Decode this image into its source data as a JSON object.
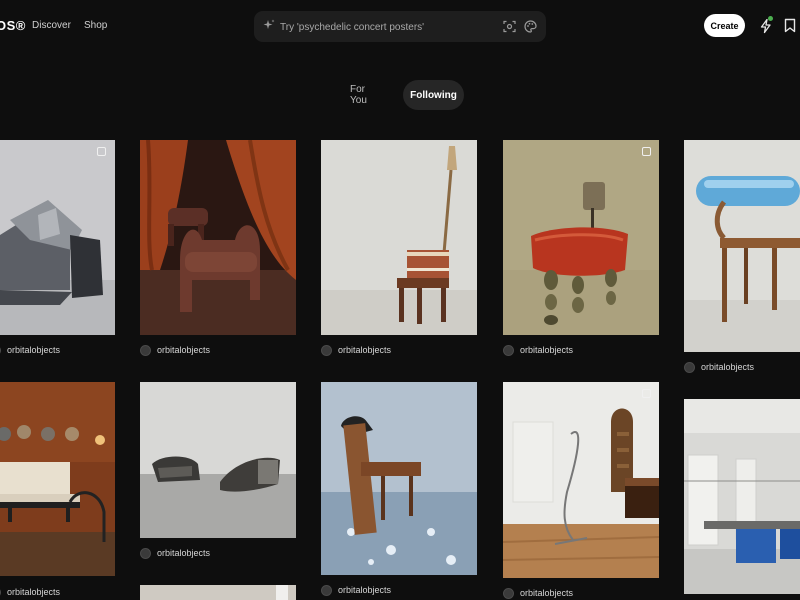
{
  "header": {
    "logo_text": "OS®",
    "nav": [
      "Discover",
      "Shop"
    ],
    "search_placeholder": "Try 'psychedelic concert posters'",
    "create_label": "Create",
    "notification_dot_color": "#4caf50"
  },
  "tabs": [
    {
      "label": "For You",
      "active": false
    },
    {
      "label": "Following",
      "active": true
    }
  ],
  "feed": {
    "author": "orbitalobjects",
    "cards": [
      {
        "name": "card-1",
        "author": "orbitalobjects",
        "multi": true
      },
      {
        "name": "card-2",
        "author": "orbitalobjects",
        "multi": false
      },
      {
        "name": "card-3",
        "author": "orbitalobjects",
        "multi": false
      },
      {
        "name": "card-4",
        "author": "orbitalobjects",
        "multi": true
      },
      {
        "name": "card-5",
        "author": "orbitalobjects",
        "multi": false
      },
      {
        "name": "card-6",
        "author": "orbitalobjects",
        "multi": false
      },
      {
        "name": "card-7",
        "author": "orbitalobjects",
        "multi": false
      },
      {
        "name": "card-8",
        "author": "orbitalobjects",
        "multi": false
      },
      {
        "name": "card-9",
        "author": "orbitalobjects",
        "multi": true
      },
      {
        "name": "card-10",
        "author": "",
        "multi": false
      }
    ]
  }
}
